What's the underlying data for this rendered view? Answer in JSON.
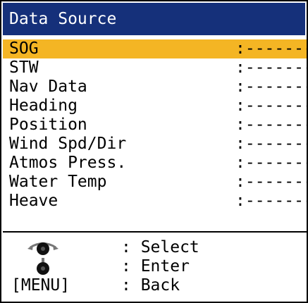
{
  "title": "Data Source",
  "items": [
    {
      "label": "SOG",
      "value": ":-------"
    },
    {
      "label": "STW",
      "value": ":-------"
    },
    {
      "label": "Nav Data",
      "value": ":-------"
    },
    {
      "label": "Heading",
      "value": ":-------"
    },
    {
      "label": "Position",
      "value": ":-------"
    },
    {
      "label": "Wind Spd/Dir",
      "value": ":-------"
    },
    {
      "label": "Atmos Press.",
      "value": ":-------"
    },
    {
      "label": "Water Temp",
      "value": ":-------"
    },
    {
      "label": "Heave",
      "value": ":-------"
    }
  ],
  "selected_index": 0,
  "colors": {
    "title_bg": "#15307a",
    "selection": "#f4b524"
  },
  "legend": [
    {
      "icon": "rotary-knob-turn-icon",
      "desc": ": Select"
    },
    {
      "icon": "rotary-knob-push-icon",
      "desc": ": Enter"
    },
    {
      "key": "[MENU]",
      "desc": ": Back"
    }
  ]
}
